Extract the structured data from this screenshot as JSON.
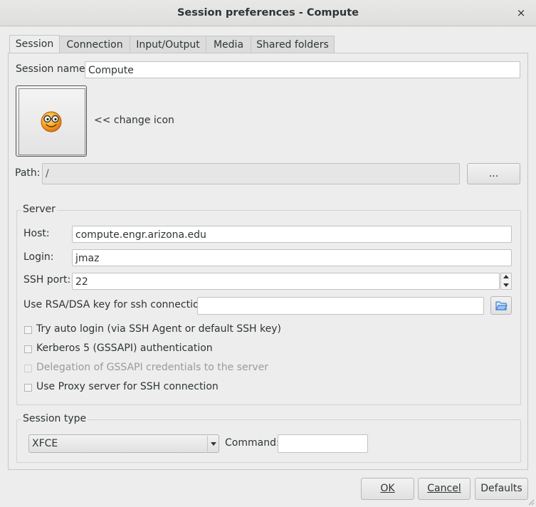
{
  "window": {
    "title": "Session preferences - Compute",
    "close_glyph": "×"
  },
  "tabs": [
    {
      "label": "Session",
      "active": true
    },
    {
      "label": "Connection",
      "active": false
    },
    {
      "label": "Input/Output",
      "active": false
    },
    {
      "label": "Media",
      "active": false
    },
    {
      "label": "Shared folders",
      "active": false
    }
  ],
  "session": {
    "name_label": "Session name:",
    "name_value": "Compute",
    "change_icon_label": "<< change icon",
    "icon": "smiley-glasses-icon",
    "path_label": "Path:",
    "path_value": "/",
    "path_browse_label": "..."
  },
  "server": {
    "group_title": "Server",
    "host_label": "Host:",
    "host_value": "compute.engr.arizona.edu",
    "login_label": "Login:",
    "login_value": "jmaz",
    "port_label": "SSH port:",
    "port_value": "22",
    "key_label": "Use RSA/DSA key for ssh connection:",
    "key_value": "",
    "options": [
      {
        "label": "Try auto login (via SSH Agent or default SSH key)",
        "checked": false,
        "enabled": true
      },
      {
        "label": "Kerberos 5 (GSSAPI) authentication",
        "checked": false,
        "enabled": true
      },
      {
        "label": "Delegation of GSSAPI credentials to the server",
        "checked": false,
        "enabled": false
      },
      {
        "label": "Use Proxy server for SSH connection",
        "checked": false,
        "enabled": true
      }
    ]
  },
  "session_type": {
    "group_title": "Session type",
    "selected": "XFCE",
    "command_label": "Command:",
    "command_value": ""
  },
  "buttons": {
    "ok": "OK",
    "cancel": "Cancel",
    "defaults": "Defaults"
  },
  "colors": {
    "background": "#ededed",
    "input_bg": "#ffffff",
    "border": "#c6c6c6",
    "folder_icon": "#3f7fd4"
  }
}
